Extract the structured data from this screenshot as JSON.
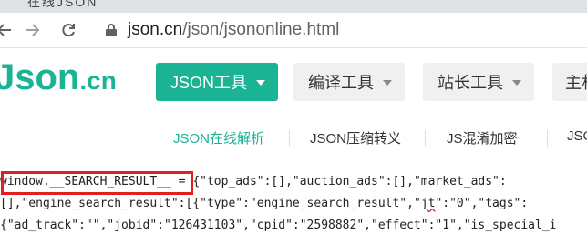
{
  "browser": {
    "tab_title": "在线JSON",
    "url_domain": "json.cn",
    "url_path": "/json/jsononline.html",
    "icons": [
      "back-arrow-icon",
      "forward-arrow-icon",
      "reload-icon",
      "lock-icon"
    ]
  },
  "site": {
    "logo_main": "Json",
    "logo_suffix": ".cn",
    "brand_color": "#1ab394",
    "nav": [
      {
        "label": "JSON工具",
        "active": true
      },
      {
        "label": "编译工具",
        "active": false
      },
      {
        "label": "站长工具",
        "active": false
      },
      {
        "label": "主机",
        "active": false
      }
    ]
  },
  "subtabs": [
    {
      "label": "JSON在线解析",
      "active": true
    },
    {
      "label": "JSON压缩转义",
      "active": false
    },
    {
      "label": "JS混淆加密",
      "active": false
    },
    {
      "label": "JSO",
      "active": false
    }
  ],
  "content": {
    "line1_highlight": "window.__SEARCH_RESULT__ =",
    "line1_rest": " {\"top_ads\":[],\"auction_ads\":[],\"market_ads\":",
    "line2_a": "[],\"engine_search_result\":[{\"type\":\"engine_search_result\",\"",
    "line2_jt": "jt",
    "line2_b": "\":\"0\",\"tags\":",
    "line3": "{\"ad_track\":\"\",\"jobid\":\"126431103\",\"cpid\":\"2598882\",\"effect\":\"1\",\"is_special_i",
    "annotation_color": "#e02020"
  }
}
